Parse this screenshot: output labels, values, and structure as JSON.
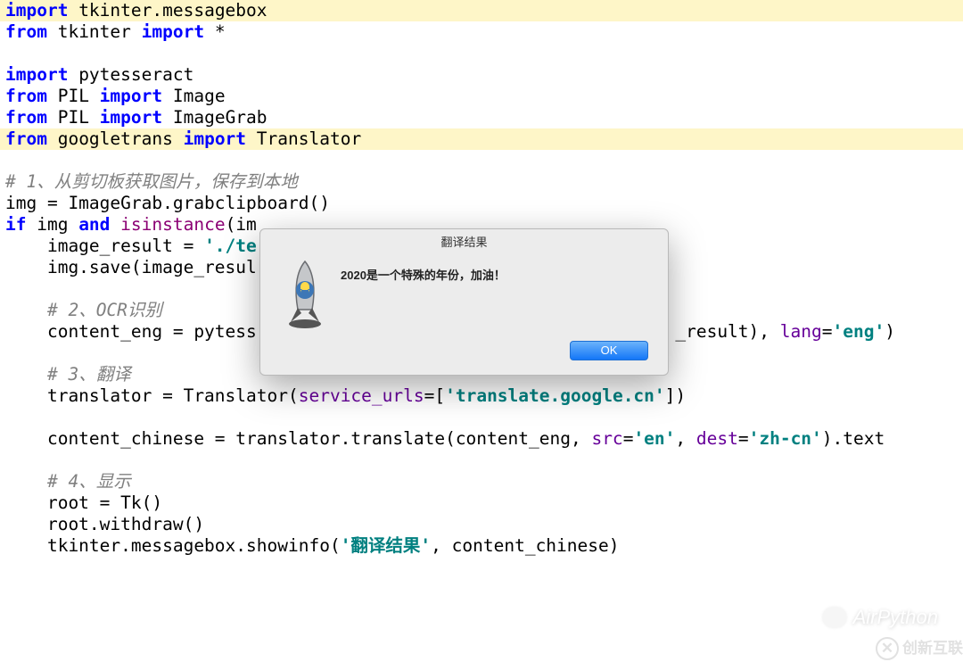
{
  "code": {
    "lines": [
      {
        "hl": true,
        "segs": [
          {
            "c": "kw",
            "t": "import"
          },
          {
            "c": "plain",
            "t": " tkinter.messagebox"
          }
        ]
      },
      {
        "segs": [
          {
            "c": "kw",
            "t": "from"
          },
          {
            "c": "plain",
            "t": " tkinter "
          },
          {
            "c": "kw",
            "t": "import"
          },
          {
            "c": "plain",
            "t": " *"
          }
        ]
      },
      {
        "segs": []
      },
      {
        "segs": [
          {
            "c": "kw",
            "t": "import"
          },
          {
            "c": "plain",
            "t": " pytesseract"
          }
        ]
      },
      {
        "segs": [
          {
            "c": "kw",
            "t": "from"
          },
          {
            "c": "plain",
            "t": " PIL "
          },
          {
            "c": "kw",
            "t": "import"
          },
          {
            "c": "plain",
            "t": " Image"
          }
        ]
      },
      {
        "segs": [
          {
            "c": "kw",
            "t": "from"
          },
          {
            "c": "plain",
            "t": " PIL "
          },
          {
            "c": "kw",
            "t": "import"
          },
          {
            "c": "plain",
            "t": " ImageGrab"
          }
        ]
      },
      {
        "hl": true,
        "segs": [
          {
            "c": "kw",
            "t": "from"
          },
          {
            "c": "plain",
            "t": " googletrans "
          },
          {
            "c": "kw",
            "t": "import"
          },
          {
            "c": "plain",
            "t": " Translator"
          }
        ]
      },
      {
        "segs": []
      },
      {
        "segs": [
          {
            "c": "comment",
            "t": "# 1、从剪切板获取图片，保存到本地"
          }
        ]
      },
      {
        "segs": [
          {
            "c": "plain",
            "t": "img = ImageGrab.grabclipboard()"
          }
        ]
      },
      {
        "segs": [
          {
            "c": "kw",
            "t": "if"
          },
          {
            "c": "plain",
            "t": " img "
          },
          {
            "c": "kw",
            "t": "and"
          },
          {
            "c": "plain",
            "t": " "
          },
          {
            "c": "builtin",
            "t": "isinstance"
          },
          {
            "c": "plain",
            "t": "(im"
          }
        ]
      },
      {
        "segs": [
          {
            "c": "plain",
            "t": "    image_result = "
          },
          {
            "c": "string",
            "t": "'./te"
          }
        ]
      },
      {
        "segs": [
          {
            "c": "plain",
            "t": "    img.save(image_resul"
          }
        ]
      },
      {
        "segs": []
      },
      {
        "segs": [
          {
            "c": "plain",
            "t": "    "
          },
          {
            "c": "comment",
            "t": "# 2、OCR识别"
          }
        ]
      },
      {
        "segs": [
          {
            "c": "plain",
            "t": "    content_eng = pytess                                        _result), "
          },
          {
            "c": "param",
            "t": "lang"
          },
          {
            "c": "plain",
            "t": "="
          },
          {
            "c": "string",
            "t": "'eng'"
          },
          {
            "c": "plain",
            "t": ")"
          }
        ]
      },
      {
        "segs": []
      },
      {
        "segs": [
          {
            "c": "plain",
            "t": "    "
          },
          {
            "c": "comment",
            "t": "# 3、翻译"
          }
        ]
      },
      {
        "segs": [
          {
            "c": "plain",
            "t": "    translator = Translator("
          },
          {
            "c": "param",
            "t": "service_urls"
          },
          {
            "c": "plain",
            "t": "=["
          },
          {
            "c": "string",
            "t": "'translate.google.cn'"
          },
          {
            "c": "plain",
            "t": "])"
          }
        ]
      },
      {
        "segs": []
      },
      {
        "segs": [
          {
            "c": "plain",
            "t": "    content_chinese = translator.translate(content_eng, "
          },
          {
            "c": "param",
            "t": "src"
          },
          {
            "c": "plain",
            "t": "="
          },
          {
            "c": "string",
            "t": "'en'"
          },
          {
            "c": "plain",
            "t": ", "
          },
          {
            "c": "param",
            "t": "dest"
          },
          {
            "c": "plain",
            "t": "="
          },
          {
            "c": "string",
            "t": "'zh-cn'"
          },
          {
            "c": "plain",
            "t": ").text"
          }
        ]
      },
      {
        "segs": []
      },
      {
        "segs": [
          {
            "c": "plain",
            "t": "    "
          },
          {
            "c": "comment",
            "t": "# 4、显示"
          }
        ]
      },
      {
        "segs": [
          {
            "c": "plain",
            "t": "    root = Tk()"
          }
        ]
      },
      {
        "segs": [
          {
            "c": "plain",
            "t": "    root.withdraw()"
          }
        ]
      },
      {
        "segs": [
          {
            "c": "plain",
            "t": "    tkinter.messagebox.showinfo("
          },
          {
            "c": "string",
            "t": "'翻译结果'"
          },
          {
            "c": "plain",
            "t": ", content_chinese)"
          }
        ]
      }
    ]
  },
  "dialog": {
    "title": "翻译结果",
    "message": "2020是一个特殊的年份，加油！",
    "ok_label": "OK",
    "icon_name": "python-rocket-icon"
  },
  "watermarks": {
    "wechat_label": "AirPython",
    "brand_label": "创新互联",
    "brand_badge": "✕"
  }
}
